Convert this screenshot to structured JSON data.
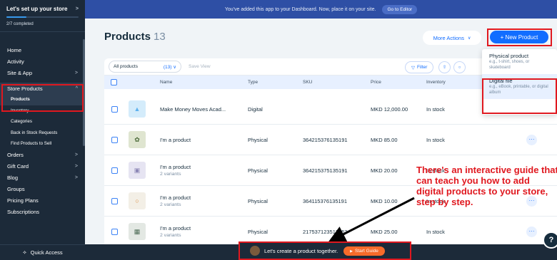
{
  "sidebar": {
    "setup_title": "Let's set up your store",
    "progress_fraction": 0.28,
    "completed": "2/7 completed",
    "items": [
      {
        "label": "Home",
        "chevron": ""
      },
      {
        "label": "Activity",
        "chevron": ""
      },
      {
        "label": "Site & App",
        "chevron": ">"
      },
      {
        "label": "Store Products",
        "chevron": "^"
      }
    ],
    "subitems": [
      "Products",
      "Inventory",
      "Categories",
      "Back in Stock Requests",
      "Find Products to Sell"
    ],
    "items2": [
      {
        "label": "Orders",
        "chevron": ">"
      },
      {
        "label": "Gift Card",
        "chevron": ">"
      },
      {
        "label": "Blog",
        "chevron": ">"
      },
      {
        "label": "Groups",
        "chevron": ""
      },
      {
        "label": "Pricing Plans",
        "chevron": ""
      },
      {
        "label": "Subscriptions",
        "chevron": ""
      }
    ],
    "quick_access": "Quick Access"
  },
  "banner": {
    "text": "You've added this app to your Dashboard. Now, place it on your site.",
    "button": "Go to Editor"
  },
  "header": {
    "title": "Products",
    "count": "13",
    "more_actions": "More Actions",
    "new_product": "+ New Product"
  },
  "toolbar": {
    "filter_select": "All products",
    "filter_count": "(13)",
    "save_view": "Save View",
    "filter": "Filter"
  },
  "table": {
    "columns": [
      "Name",
      "Type",
      "SKU",
      "Price",
      "Inventory"
    ],
    "rows": [
      {
        "name": "Make Money Moves Acad...",
        "variants": "",
        "type": "Digital",
        "sku": "",
        "price": "MKD 12,000.00",
        "inventory": "In stock"
      },
      {
        "name": "I'm a product",
        "variants": "",
        "type": "Physical",
        "sku": "364215376135191",
        "price": "MKD 85.00",
        "inventory": "In stock"
      },
      {
        "name": "I'm a product",
        "variants": "2 variants",
        "type": "Physical",
        "sku": "364215375135191",
        "price": "MKD 20.00",
        "inventory": "In stock"
      },
      {
        "name": "I'm a product",
        "variants": "2 variants",
        "type": "Physical",
        "sku": "364115376135191",
        "price": "MKD 10.00",
        "inventory": "In stock"
      },
      {
        "name": "I'm a product",
        "variants": "2 variants",
        "type": "Physical",
        "sku": "217537123517253",
        "price": "MKD 25.00",
        "inventory": "In stock"
      }
    ]
  },
  "dropdown": {
    "items": [
      {
        "label": "Physical product",
        "desc": "e.g., t-shirt, shoes, or skateboard"
      },
      {
        "label": "Digital file",
        "desc": "e.g., eBook, printable, or digital album"
      }
    ]
  },
  "annotation": "There's an interactive guide that can teach you how to add digital products to your store, step by step.",
  "guide": {
    "text": "Let's create a product together.",
    "button": "Start Guide"
  },
  "colors": {
    "accent": "#116dff",
    "highlight": "#e0181f",
    "sidebar": "#1c2a39",
    "banner": "#2e4fa5"
  }
}
